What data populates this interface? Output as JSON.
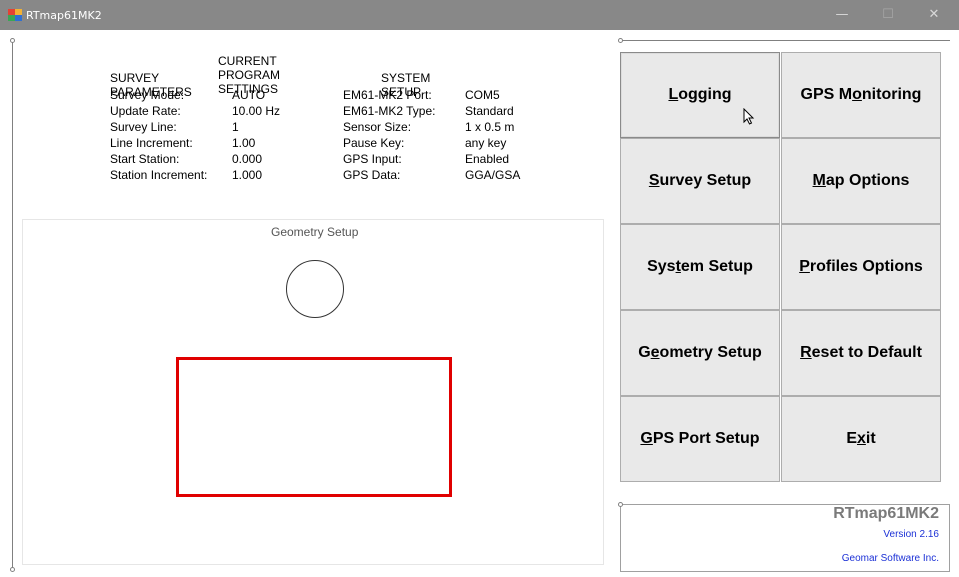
{
  "window": {
    "title": "RTmap61MK2",
    "controls": {
      "minimize": "—",
      "maximize": "☐",
      "close": "✕"
    }
  },
  "settings": {
    "heading": "CURRENT PROGRAM SETTINGS",
    "survey": {
      "heading": "SURVEY PARAMETERS",
      "rows": [
        {
          "label": "Survey Mode:",
          "value": "AUTO"
        },
        {
          "label": "Update Rate:",
          "value": "10.00 Hz"
        },
        {
          "label": "Survey Line:",
          "value": "1"
        },
        {
          "label": "Line Increment:",
          "value": "1.00"
        },
        {
          "label": "Start Station:",
          "value": "0.000"
        },
        {
          "label": "Station Increment:",
          "value": "1.000"
        }
      ]
    },
    "system": {
      "heading": "SYSTEM SETUP",
      "rows": [
        {
          "label": "EM61-MK2 Port:",
          "value": "COM5"
        },
        {
          "label": "EM61-MK2 Type:",
          "value": "Standard"
        },
        {
          "label": "Sensor Size:",
          "value": "1 x 0.5 m"
        },
        {
          "label": "Pause Key:",
          "value": "any key"
        },
        {
          "label": "GPS Input:",
          "value": "Enabled"
        },
        {
          "label": "GPS Data:",
          "value": "GGA/GSA"
        }
      ]
    }
  },
  "geometry": {
    "title": "Geometry Setup"
  },
  "buttons": [
    {
      "pre": "",
      "key": "L",
      "post": "ogging"
    },
    {
      "pre": "GPS M",
      "key": "o",
      "post": "nitoring"
    },
    {
      "pre": "",
      "key": "S",
      "post": "urvey Setup"
    },
    {
      "pre": "",
      "key": "M",
      "post": "ap Options"
    },
    {
      "pre": "Sys",
      "key": "t",
      "post": "em Setup"
    },
    {
      "pre": "",
      "key": "P",
      "post": "rofiles Options"
    },
    {
      "pre": "G",
      "key": "e",
      "post": "ometry Setup"
    },
    {
      "pre": "",
      "key": "R",
      "post": "eset to Default"
    },
    {
      "pre": "",
      "key": "G",
      "post": "PS Port Setup"
    },
    {
      "pre": "E",
      "key": "x",
      "post": "it"
    }
  ],
  "info": {
    "app_name": "RTmap61MK2",
    "version": "Version 2.16",
    "company": "Geomar Software Inc."
  },
  "colors": {
    "titlebar": "#888888",
    "geometry_rect": "#e00000",
    "info_text": "#1c31d6"
  }
}
